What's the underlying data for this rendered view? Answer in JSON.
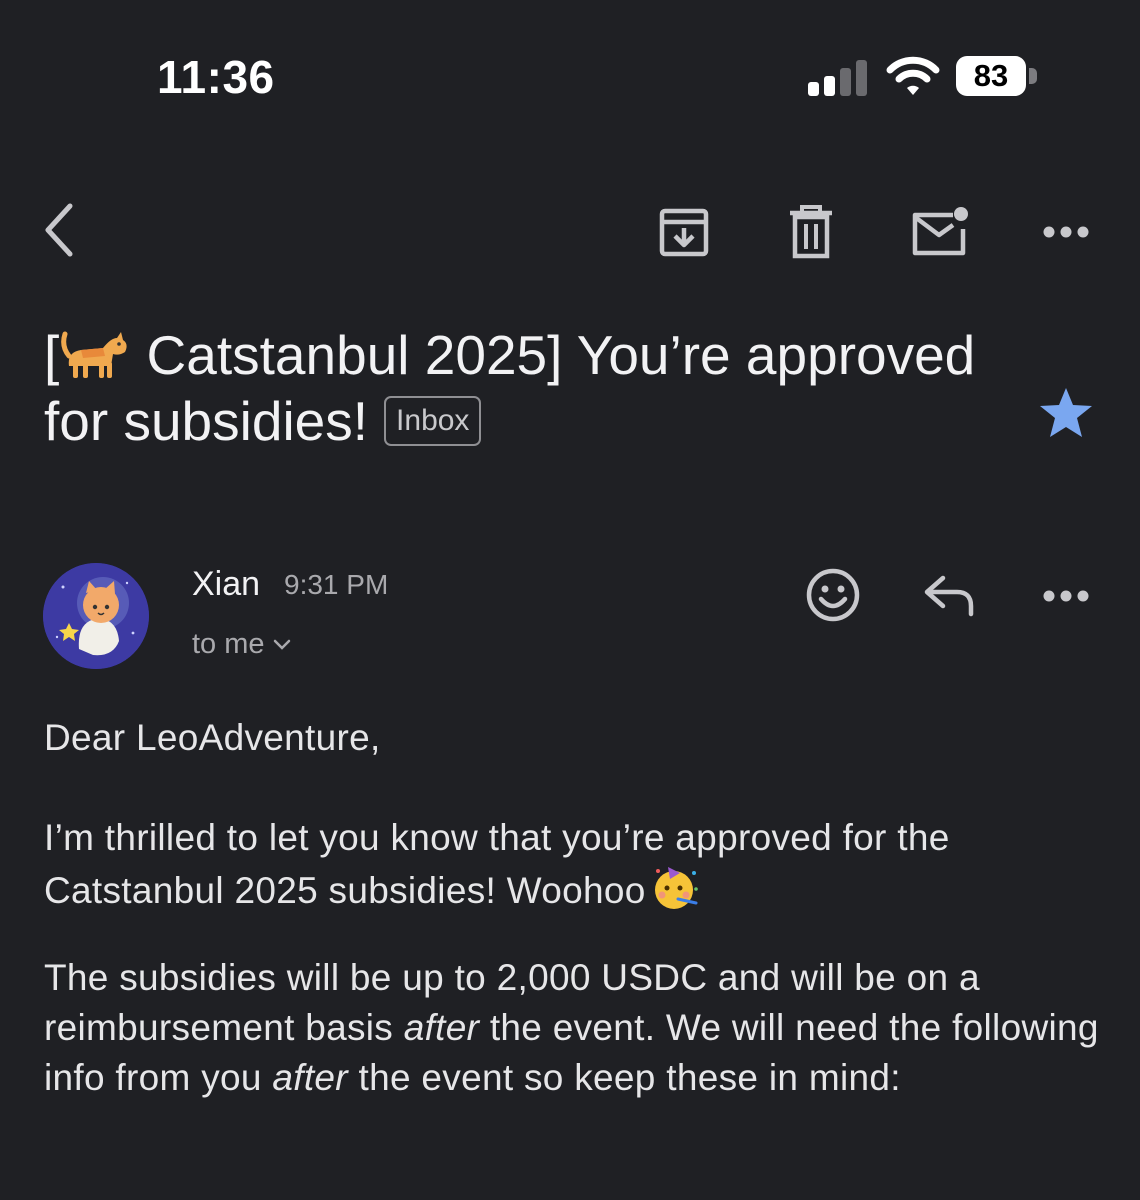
{
  "status_bar": {
    "time": "11:36",
    "battery": "83",
    "icons": [
      "signal-icon",
      "wifi-icon",
      "battery-icon"
    ]
  },
  "toolbar": {
    "icons": [
      "back-icon",
      "archive-icon",
      "trash-icon",
      "mark-unread-icon",
      "more-icon"
    ]
  },
  "email": {
    "subject_prefix": "[",
    "subject_main": " Catstanbul 2025] You’re approved for subsidies!",
    "label": "Inbox",
    "starred": true,
    "star_color": "#7aa7f0",
    "sender": {
      "name": "Xian",
      "time": "9:31 PM",
      "recipient": "to me",
      "avatar_color": "#3f3aa6"
    },
    "body": {
      "greeting": "Dear LeoAdventure,",
      "para1": "I’m thrilled to let you know that you’re approved for the Catstanbul 2025 subsidies! Woohoo",
      "para2_a": "The subsidies will be up to 2,000 USDC and will be on a reimbursement basis ",
      "para2_em1": "after",
      "para2_b": " the event. We will need the following info from you ",
      "para2_em2": "after",
      "para2_c": " the event so keep these in mind:"
    }
  },
  "colors": {
    "background": "#1f2024",
    "text": "#e6e6e8",
    "muted": "#a9a9ad"
  }
}
